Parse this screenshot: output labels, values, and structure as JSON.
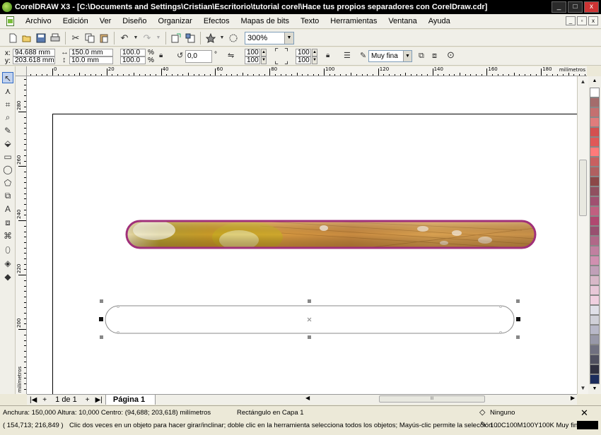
{
  "window": {
    "title": "CorelDRAW X3 - [C:\\Documents and Settings\\Cristian\\Escritorio\\tutorial corel\\Hace tus propios separadores con CorelDraw.cdr]",
    "controls": [
      "_",
      "□",
      "x"
    ]
  },
  "menu": {
    "items": [
      "Archivo",
      "Edición",
      "Ver",
      "Diseño",
      "Organizar",
      "Efectos",
      "Mapas de bits",
      "Texto",
      "Herramientas",
      "Ventana",
      "Ayuda"
    ],
    "doc_controls": [
      "_",
      "▫",
      "x"
    ]
  },
  "toolbar": {
    "zoom": "300%"
  },
  "properties": {
    "x_label": "x:",
    "x": "94.688 mm",
    "y_label": "y:",
    "y": "203.618 mm",
    "width": "150.0 mm",
    "height": "10.0 mm",
    "scale_w": "100.0",
    "scale_h": "100.0",
    "percent": "%",
    "rotation": "0,0",
    "degree": "°",
    "corner_tl": "100",
    "corner_bl": "100",
    "corner_tr": "100",
    "corner_br": "100",
    "outline_width": "Muy fina"
  },
  "rulers": {
    "h_unit": "milímetros",
    "v_unit": "milímetros",
    "h_labels": [
      "0",
      "20",
      "40",
      "60",
      "80",
      "100",
      "120",
      "140",
      "160",
      "180"
    ],
    "v_labels": [
      "280",
      "260",
      "240",
      "220",
      "200"
    ]
  },
  "pages": {
    "count": "1 de 1",
    "tab": "Página 1"
  },
  "status": {
    "dims": "Anchura: 150,000  Altura: 10,000  Centro: (94,688; 203,618)  milímetros",
    "object": "Rectángulo en Capa 1",
    "fill": "Ninguno",
    "cursor": "( 154,713; 216,849 )",
    "hint": "Clic dos veces en un objeto para hacer girar/inclinar; doble clic en la herramienta selecciona todos los objetos; Mayús-clic permite la selección ...",
    "outline": "100C100M100Y100K  Muy fina"
  },
  "palette": {
    "colors": [
      "#ffffff",
      "#a46c6c",
      "#c47070",
      "#e07c7c",
      "#d45050",
      "#e05858",
      "#ff7a7a",
      "#c86060",
      "#b06060",
      "#8c4848",
      "#905060",
      "#a05070",
      "#c06080",
      "#b04870",
      "#985070",
      "#b06888",
      "#c080a0",
      "#d090b0",
      "#c0a0b8",
      "#d8b8c8",
      "#e8c8d8",
      "#f0d0e0",
      "#e0e0e8",
      "#d0d0d8",
      "#b8b8c8",
      "#9898a8",
      "#707080",
      "#505060",
      "#303040",
      "#1c2c5c"
    ]
  },
  "colors": {
    "accent": "#316ac5",
    "titlebar": "#000000",
    "chrome": "#ece9d8",
    "bar_outline": "#a0307a"
  }
}
